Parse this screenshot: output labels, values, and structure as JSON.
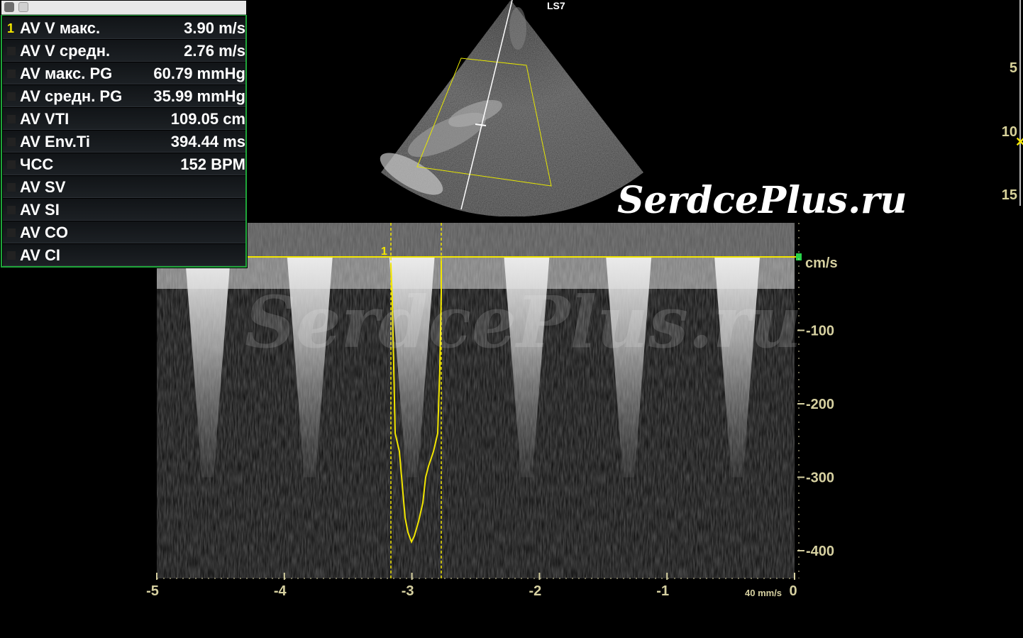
{
  "measurements": {
    "rows": [
      {
        "index": "1",
        "label": "AV V макс.",
        "value": "3.90 m/s"
      },
      {
        "index": "",
        "label": "AV V средн.",
        "value": "2.76 m/s"
      },
      {
        "index": "",
        "label": "AV макс. PG",
        "value": "60.79 mmHg"
      },
      {
        "index": "",
        "label": "AV средн. PG",
        "value": "35.99 mmHg"
      },
      {
        "index": "",
        "label": "AV VTI",
        "value": "109.05 cm"
      },
      {
        "index": "",
        "label": "AV Env.Ti",
        "value": "394.44 ms"
      },
      {
        "index": "",
        "label": "ЧСС",
        "value": "152 BPM"
      },
      {
        "index": "",
        "label": "AV SV",
        "value": ""
      },
      {
        "index": "",
        "label": "AV SI",
        "value": ""
      },
      {
        "index": "",
        "label": "AV CO",
        "value": ""
      },
      {
        "index": "",
        "label": "AV CI",
        "value": ""
      }
    ]
  },
  "image": {
    "probe": "LS7",
    "watermark": "SerdcePlus.ru",
    "depth_scale": [
      "5",
      "10",
      "15"
    ]
  },
  "doppler": {
    "unit": "cm/s",
    "sweep_speed": "40 mm/s",
    "y_ticks": [
      "-100",
      "-200",
      "-300",
      "-400"
    ],
    "x_ticks": [
      "-5",
      "-4",
      "-3",
      "-2",
      "-1",
      "0"
    ],
    "cursor_label": "1",
    "peak_velocity_cm_s": -385,
    "colors": {
      "trace": "#f2e600",
      "axis": "#d6d0a0",
      "panel_border": "#1fa63a"
    }
  }
}
